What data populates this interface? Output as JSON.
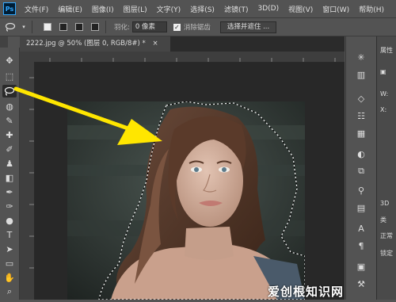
{
  "app": {
    "logo": "Ps",
    "menu": [
      "文件(F)",
      "编辑(E)",
      "图像(I)",
      "图层(L)",
      "文字(Y)",
      "选择(S)",
      "滤镜(T)",
      "3D(D)",
      "视图(V)",
      "窗口(W)",
      "帮助(H)"
    ]
  },
  "options": {
    "feather_label": "羽化:",
    "feather_value": "0 像素",
    "antialias_label": "消除锯齿",
    "antialias_checked": true,
    "select_mask_button": "选择并遮住 ..."
  },
  "document": {
    "tab_title": "2222.jpg @ 50% (图层 0, RGB/8#) *",
    "close_glyph": "×"
  },
  "toolbar": {
    "icons": [
      "move-icon",
      "marquee-icon",
      "lasso-icon",
      "quick-select-icon",
      "crop-icon",
      "eyedropper-icon",
      "healing-brush-icon",
      "brush-icon",
      "clone-stamp-icon",
      "history-brush-icon",
      "eraser-icon",
      "gradient-icon",
      "blur-icon",
      "dodge-icon",
      "pen-icon",
      "type-icon",
      "path-select-icon",
      "rectangle-icon",
      "hand-icon",
      "zoom-icon"
    ],
    "type_glyph": "T"
  },
  "right_panel": {
    "title": "属性",
    "w_label": "W:",
    "x_label": "X:",
    "tab_3d": "3D",
    "kind_label": "类",
    "blend_mode": "正常",
    "lock_label": "锁定"
  },
  "annotation": {
    "arrow_color": "#ffe600",
    "points_to": "lasso-icon"
  },
  "watermark": {
    "text": "爱创根知识网",
    "sub": "www"
  },
  "colors": {
    "ui_bg": "#535353",
    "workspace": "#282828",
    "selection": "marching-ants",
    "ps_blue": "#31a8ff"
  }
}
